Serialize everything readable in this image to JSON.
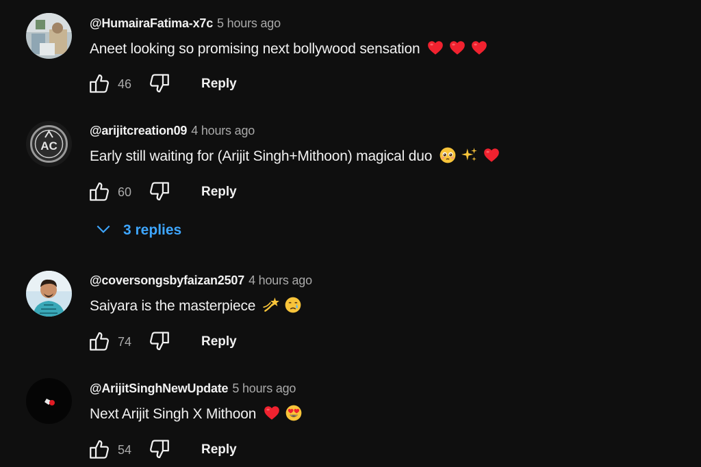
{
  "comments": [
    {
      "handle": "@HumairaFatima-x7c",
      "time": "5 hours ago",
      "text": "Aneet looking so promising next bollywood sensation",
      "emojis": [
        "red-heart-emoji",
        "red-heart-emoji",
        "red-heart-emoji"
      ],
      "likes": "46",
      "reply_label": "Reply"
    },
    {
      "handle": "@arijitcreation09",
      "time": "4 hours ago",
      "text": "Early still waiting for (Arijit Singh+Mithoon) magical duo",
      "emojis": [
        "pleading-face-emoji",
        "sparkles-emoji",
        "red-heart-emoji"
      ],
      "likes": "60",
      "reply_label": "Reply",
      "replies_label": "3 replies",
      "avatar_text": "AC"
    },
    {
      "handle": "@coversongsbyfaizan2507",
      "time": "4 hours ago",
      "text": "Saiyara is the masterpiece",
      "emojis": [
        "dizzy-emoji",
        "crying-face-emoji"
      ],
      "likes": "74",
      "reply_label": "Reply"
    },
    {
      "handle": "@ArijitSinghNewUpdate",
      "time": "5 hours ago",
      "text": "Next Arijit Singh X Mithoon",
      "emojis": [
        "red-heart-emoji",
        "heart-eyes-emoji"
      ],
      "likes": "54",
      "reply_label": "Reply"
    }
  ],
  "colors": {
    "background": "#0f0f0f",
    "primary_text": "#f1f1f1",
    "secondary_text": "#aaaaaa",
    "link_blue": "#3ea6ff",
    "heart_red": "#f0222f"
  }
}
